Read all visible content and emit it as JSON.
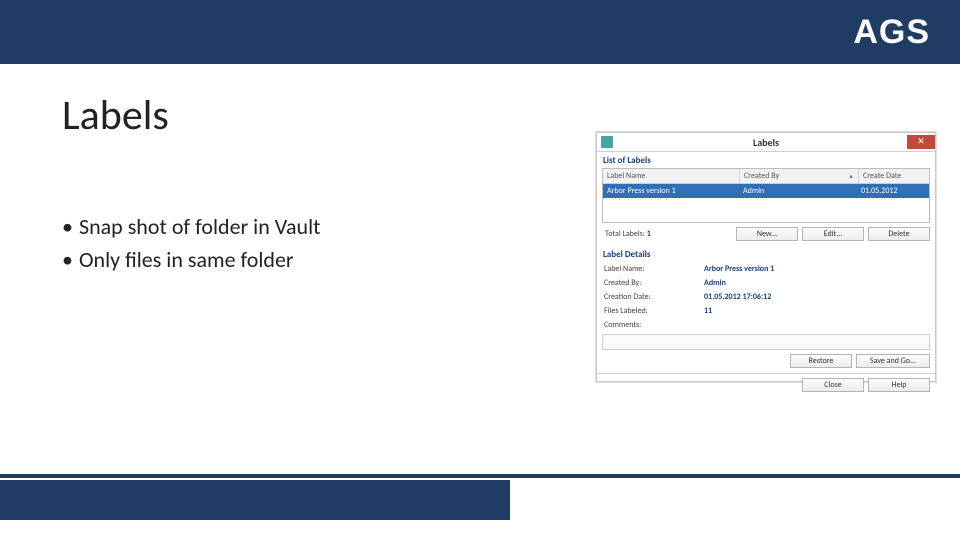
{
  "header": {
    "brand": "AGS"
  },
  "title": "Labels",
  "bullets": [
    "Snap shot of folder in Vault",
    "Only files in same folder"
  ],
  "dialog": {
    "window_title": "Labels",
    "close_glyph": "✕",
    "list_header": "List of Labels",
    "columns": {
      "name": "Label Name",
      "created_by": "Created By",
      "create_date": "Create Date",
      "sort_glyph": "▲"
    },
    "row": {
      "name": "Arbor Press version 1",
      "created_by": "Admin",
      "create_date": "01.05.2012"
    },
    "total": {
      "label": "Total Labels:",
      "value": "1"
    },
    "buttons": {
      "new": "New...",
      "edit": "Edit...",
      "delete": "Delete",
      "restore": "Restore",
      "save_and_go": "Save and Go...",
      "close": "Close",
      "help": "Help"
    },
    "details_header": "Label Details",
    "details": {
      "label_name": {
        "k": "Label Name:",
        "v": "Arbor Press version 1"
      },
      "created_by": {
        "k": "Created By:",
        "v": "Admin"
      },
      "creation_date": {
        "k": "Creation Date:",
        "v": "01.05.2012 17:06:12"
      },
      "files_labeled": {
        "k": "Files Labeled:",
        "v": "11"
      },
      "comments": {
        "k": "Comments:"
      }
    }
  }
}
